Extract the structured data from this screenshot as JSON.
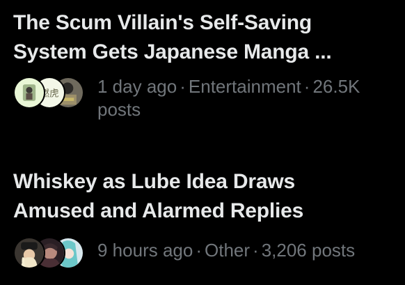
{
  "trends": [
    {
      "title_line1": "The Scum Villain's Self-Saving",
      "title_line2": "System Gets Japanese Manga ...",
      "time": "1 day ago",
      "category": "Entertainment",
      "posts": "26.5K posts",
      "separator": "·",
      "avatar_text": "燃虎"
    },
    {
      "title_line1": "Whiskey as Lube Idea Draws",
      "title_line2": "Amused and Alarmed Replies",
      "time": "9 hours ago",
      "category": "Other",
      "posts": "3,206 posts",
      "separator": "·"
    }
  ],
  "colors": {
    "background": "#000000",
    "title": "#e7e9ea",
    "meta": "#71767b"
  }
}
